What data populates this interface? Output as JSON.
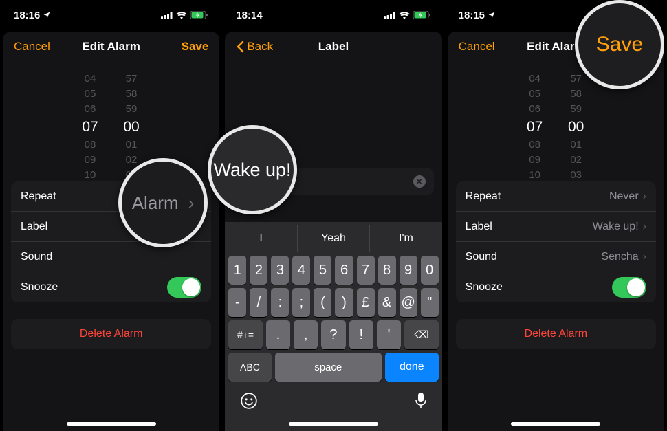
{
  "phone1": {
    "status": {
      "time": "18:16",
      "location_icon": "location",
      "signal": "signal",
      "wifi": "wifi",
      "battery": "battery-charging"
    },
    "nav": {
      "cancel": "Cancel",
      "title": "Edit Alarm",
      "save": "Save"
    },
    "picker": {
      "hours": [
        "04",
        "05",
        "06",
        "07",
        "08",
        "09",
        "10"
      ],
      "minutes": [
        "57",
        "58",
        "59",
        "00",
        "01",
        "02",
        "03"
      ],
      "selected_index": 3
    },
    "rows": {
      "repeat": {
        "label": "Repeat"
      },
      "label_row": {
        "label": "Label"
      },
      "sound": {
        "label": "Sound"
      },
      "snooze": {
        "label": "Snooze",
        "on": true
      }
    },
    "delete": "Delete Alarm",
    "magnifier": {
      "text": "Alarm",
      "chevron": "›"
    }
  },
  "phone2": {
    "status": {
      "time": "18:14"
    },
    "nav": {
      "back": "Back",
      "title": "Label"
    },
    "textfield": {
      "value": "Wake up!"
    },
    "magnifier": {
      "text": "Wake up!"
    },
    "keyboard": {
      "suggestions": [
        "I",
        "Yeah",
        "I'm"
      ],
      "row1": [
        "1",
        "2",
        "3",
        "4",
        "5",
        "6",
        "7",
        "8",
        "9",
        "0"
      ],
      "row2": [
        "-",
        "/",
        ":",
        ";",
        "(",
        ")",
        "£",
        "&",
        "@",
        "\""
      ],
      "row3_shift": "#+=",
      "row3": [
        ".",
        ",",
        "?",
        "!",
        "'"
      ],
      "row3_del": "⌫",
      "row4_abc": "ABC",
      "row4_space": "space",
      "row4_done": "done",
      "emoji": "😀",
      "mic": "🎤"
    }
  },
  "phone3": {
    "status": {
      "time": "18:15"
    },
    "nav": {
      "cancel": "Cancel",
      "title": "Edit Alarm",
      "save": "Save"
    },
    "picker": {
      "hours": [
        "04",
        "05",
        "06",
        "07",
        "08",
        "09",
        "10"
      ],
      "minutes": [
        "57",
        "58",
        "59",
        "00",
        "01",
        "02",
        "03"
      ],
      "selected_index": 3
    },
    "rows": {
      "repeat": {
        "label": "Repeat",
        "value": "Never"
      },
      "label_row": {
        "label": "Label",
        "value": "Wake up!"
      },
      "sound": {
        "label": "Sound",
        "value": "Sencha"
      },
      "snooze": {
        "label": "Snooze",
        "on": true
      }
    },
    "delete": "Delete Alarm",
    "magnifier": {
      "text": "Save"
    }
  }
}
